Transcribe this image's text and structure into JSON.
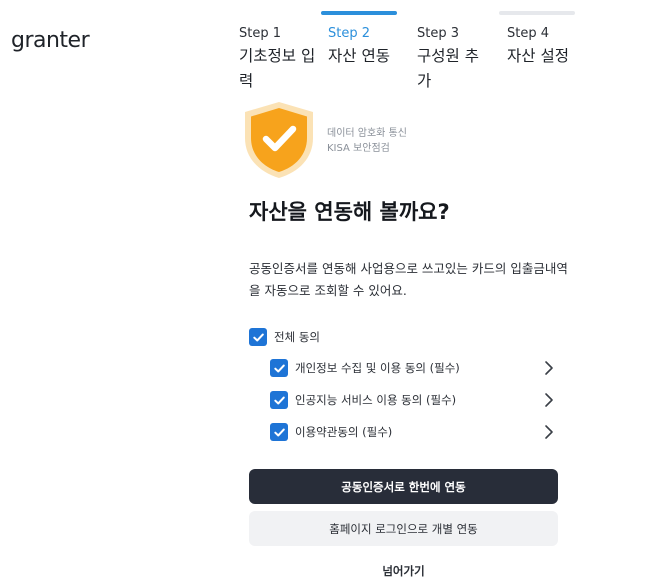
{
  "brand": {
    "logo_text": "granter"
  },
  "steps": [
    {
      "num": "Step 1",
      "name": "기초정보 입력",
      "state": "done",
      "bar_color": "#ffffff"
    },
    {
      "num": "Step 2",
      "name": "자산 연동",
      "state": "active",
      "bar_color": "#2b8fdb"
    },
    {
      "num": "Step 3",
      "name": "구성원 추가",
      "state": "todo",
      "bar_color": "#ffffff"
    },
    {
      "num": "Step 4",
      "name": "자산 설정",
      "state": "todo",
      "bar_color": "#e6e8ec"
    }
  ],
  "security": {
    "icon": "shield-check-icon",
    "line1": "데이터 암호화 통신",
    "line2": "KISA 보안점검"
  },
  "main": {
    "title": "자산을 연동해 볼까요?",
    "description": "공동인증서를 연동해 사업용으로 쓰고있는 카드의 입출금내역을 자동으로 조회할 수 있어요."
  },
  "agreements": {
    "all": {
      "label": "전체 동의",
      "checked": true
    },
    "items": [
      {
        "label": "개인정보 수집 및 이용 동의 (필수)",
        "checked": true
      },
      {
        "label": "인공지능 서비스 이용 동의 (필수)",
        "checked": true
      },
      {
        "label": "이용약관동의 (필수)",
        "checked": true
      }
    ]
  },
  "actions": {
    "primary_label": "공동인증서로 한번에 연동",
    "secondary_label": "홈페이지 로그인으로 개별 연동",
    "skip_label": "넘어가기"
  },
  "colors": {
    "accent": "#2b8fdb",
    "checkbox": "#1e74d6",
    "primary_button": "#282d39",
    "shield": "#f7a31c"
  }
}
